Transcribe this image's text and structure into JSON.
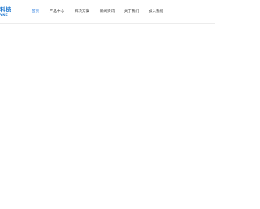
{
  "logo": {
    "main": "科技",
    "sub": "YNE"
  },
  "nav": {
    "items": [
      {
        "label": "首页",
        "active": true
      },
      {
        "label": "产品中心",
        "active": false
      },
      {
        "label": "解决方案",
        "active": false
      },
      {
        "label": "新闻资讯",
        "active": false
      },
      {
        "label": "关于我们",
        "active": false
      },
      {
        "label": "加入我们",
        "active": false
      }
    ]
  },
  "colors": {
    "accent": "#2f7fe0",
    "logo": "#1f78cf",
    "text": "#333333"
  }
}
